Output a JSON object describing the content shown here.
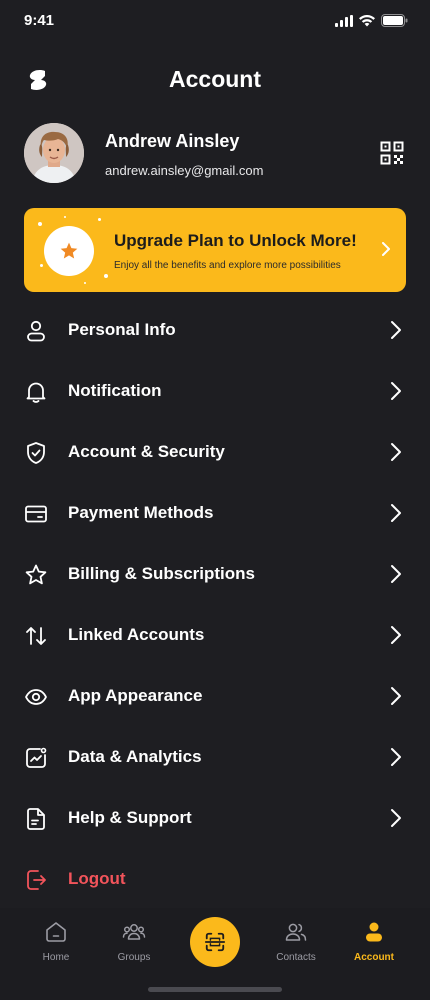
{
  "status_bar": {
    "time": "9:41"
  },
  "header": {
    "title": "Account"
  },
  "profile": {
    "name": "Andrew Ainsley",
    "email": "andrew.ainsley@gmail.com"
  },
  "upgrade": {
    "title": "Upgrade Plan to Unlock More!",
    "subtitle": "Enjoy all the benefits and explore more possibilities"
  },
  "menu": [
    {
      "label": "Personal Info",
      "icon": "user-icon"
    },
    {
      "label": "Notification",
      "icon": "bell-icon"
    },
    {
      "label": "Account & Security",
      "icon": "shield-icon"
    },
    {
      "label": "Payment Methods",
      "icon": "card-icon"
    },
    {
      "label": "Billing & Subscriptions",
      "icon": "star-icon"
    },
    {
      "label": "Linked Accounts",
      "icon": "arrows-icon"
    },
    {
      "label": "App Appearance",
      "icon": "eye-icon"
    },
    {
      "label": "Data & Analytics",
      "icon": "chart-icon"
    },
    {
      "label": "Help & Support",
      "icon": "document-icon"
    },
    {
      "label": "Logout",
      "icon": "logout-icon"
    }
  ],
  "tabs": [
    {
      "label": "Home",
      "icon": "home-icon"
    },
    {
      "label": "Groups",
      "icon": "groups-icon"
    },
    {
      "label": "Contacts",
      "icon": "contacts-icon"
    },
    {
      "label": "Account",
      "icon": "account-icon"
    }
  ],
  "colors": {
    "background": "#1e1e22",
    "accent": "#fbb91b",
    "danger": "#f2545b",
    "inactive_tab": "#9c9ca4"
  }
}
